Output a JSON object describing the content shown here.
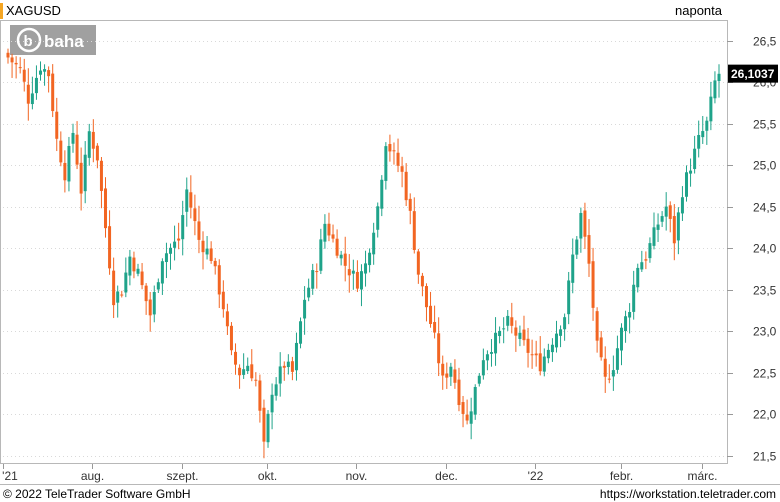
{
  "header": {
    "symbol": "XAGUSD",
    "interval": "naponta",
    "logo_text": "baha"
  },
  "footer": {
    "copyright": "© 2022 TeleTrader Software GmbH",
    "url": "https://workstation.teletrader.com"
  },
  "colors": {
    "up": "#1fa38a",
    "down": "#f26522",
    "last_price_bg": "#000000",
    "symbol_marker": "#f5a623"
  },
  "chart_data": {
    "type": "candlestick",
    "title": "XAGUSD",
    "interval": "naponta",
    "last_price": "26,1037",
    "last_price_value": 26.1037,
    "ylim": [
      21.4,
      26.75
    ],
    "y_ticks": [
      "26,5",
      "26,0",
      "25,5",
      "25,0",
      "24,5",
      "24,0",
      "23,5",
      "23,0",
      "22,5",
      "22,0",
      "21,5"
    ],
    "y_tick_values": [
      26.5,
      26.0,
      25.5,
      25.0,
      24.5,
      24.0,
      23.5,
      23.0,
      22.5,
      22.0,
      21.5
    ],
    "x_ticks": [
      "'21",
      "aug.",
      "szept.",
      "okt.",
      "nov.",
      "dec.",
      "'22",
      "febr.",
      "márc."
    ],
    "x_tick_index": [
      0,
      22,
      44,
      65,
      87,
      109,
      131,
      152,
      172
    ],
    "path": [
      [
        0,
        26.3
      ],
      [
        3,
        26.15
      ],
      [
        5,
        25.8
      ],
      [
        8,
        26.2
      ],
      [
        10,
        26.1
      ],
      [
        12,
        25.3
      ],
      [
        14,
        24.9
      ],
      [
        16,
        25.4
      ],
      [
        18,
        24.7
      ],
      [
        20,
        25.4
      ],
      [
        22,
        25.1
      ],
      [
        26,
        23.4
      ],
      [
        28,
        23.5
      ],
      [
        30,
        23.9
      ],
      [
        32,
        23.7
      ],
      [
        35,
        23.2
      ],
      [
        38,
        23.9
      ],
      [
        42,
        24.1
      ],
      [
        44,
        24.7
      ],
      [
        47,
        24.1
      ],
      [
        50,
        23.9
      ],
      [
        53,
        23.3
      ],
      [
        55,
        22.7
      ],
      [
        57,
        22.5
      ],
      [
        59,
        22.6
      ],
      [
        61,
        22.4
      ],
      [
        63,
        21.6
      ],
      [
        65,
        22.3
      ],
      [
        68,
        22.6
      ],
      [
        70,
        22.5
      ],
      [
        73,
        23.4
      ],
      [
        76,
        23.8
      ],
      [
        78,
        24.3
      ],
      [
        81,
        24.0
      ],
      [
        83,
        23.8
      ],
      [
        86,
        23.6
      ],
      [
        88,
        23.8
      ],
      [
        91,
        24.5
      ],
      [
        93,
        25.3
      ],
      [
        95,
        25.1
      ],
      [
        97,
        24.9
      ],
      [
        99,
        24.4
      ],
      [
        101,
        23.7
      ],
      [
        103,
        23.3
      ],
      [
        105,
        22.9
      ],
      [
        107,
        22.4
      ],
      [
        109,
        22.6
      ],
      [
        111,
        22.2
      ],
      [
        113,
        21.9
      ],
      [
        115,
        22.3
      ],
      [
        117,
        22.7
      ],
      [
        120,
        22.9
      ],
      [
        123,
        23.1
      ],
      [
        126,
        22.9
      ],
      [
        129,
        22.7
      ],
      [
        131,
        22.6
      ],
      [
        134,
        22.9
      ],
      [
        137,
        23.2
      ],
      [
        139,
        23.9
      ],
      [
        141,
        24.4
      ],
      [
        143,
        23.8
      ],
      [
        145,
        22.8
      ],
      [
        147,
        22.4
      ],
      [
        149,
        22.6
      ],
      [
        151,
        23.0
      ],
      [
        153,
        23.3
      ],
      [
        155,
        23.8
      ],
      [
        157,
        23.9
      ],
      [
        160,
        24.3
      ],
      [
        162,
        24.5
      ],
      [
        164,
        24.1
      ],
      [
        166,
        24.7
      ],
      [
        168,
        25.0
      ],
      [
        170,
        25.3
      ],
      [
        172,
        25.5
      ],
      [
        174,
        26.0
      ],
      [
        175,
        26.1037
      ]
    ]
  }
}
